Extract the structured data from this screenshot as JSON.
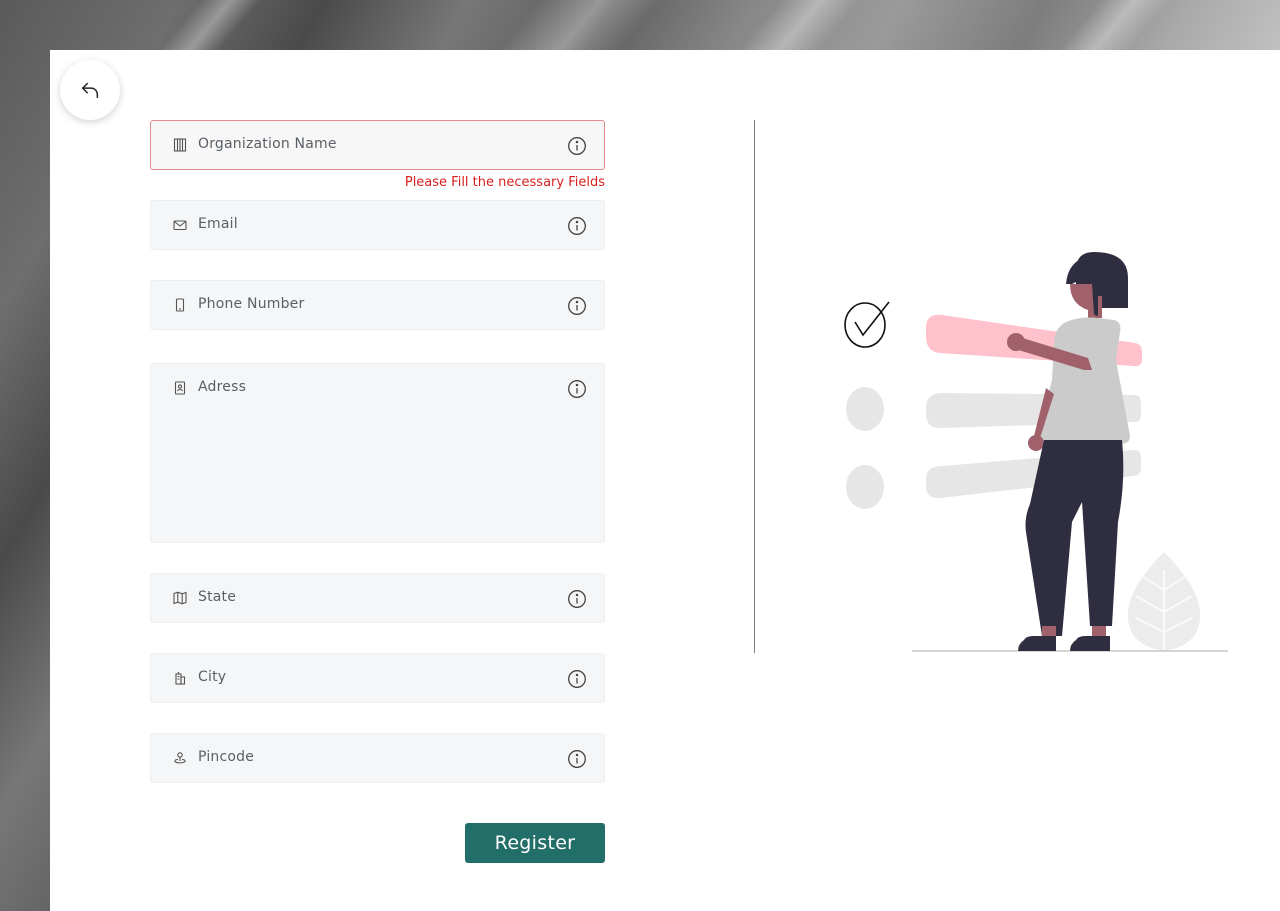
{
  "back": {
    "icon": "undo-arrow-icon"
  },
  "form": {
    "organization": {
      "label": "Organization Name",
      "icon": "building-icon",
      "error": "Please Fill the necessary Fields"
    },
    "email": {
      "label": "Email",
      "icon": "envelope-icon"
    },
    "phone": {
      "label": "Phone Number",
      "icon": "mobile-phone-icon"
    },
    "address": {
      "label": "Adress",
      "icon": "contact-book-icon"
    },
    "state": {
      "label": "State",
      "icon": "map-icon"
    },
    "city": {
      "label": "City",
      "icon": "city-buildings-icon"
    },
    "pincode": {
      "label": "Pincode",
      "icon": "location-pin-icon"
    },
    "register_label": "Register"
  },
  "colors": {
    "accent": "#226e68",
    "error": "#d81f1f",
    "highlight_bar": "#ffc1cc",
    "figure_dark": "#2f2e41"
  }
}
